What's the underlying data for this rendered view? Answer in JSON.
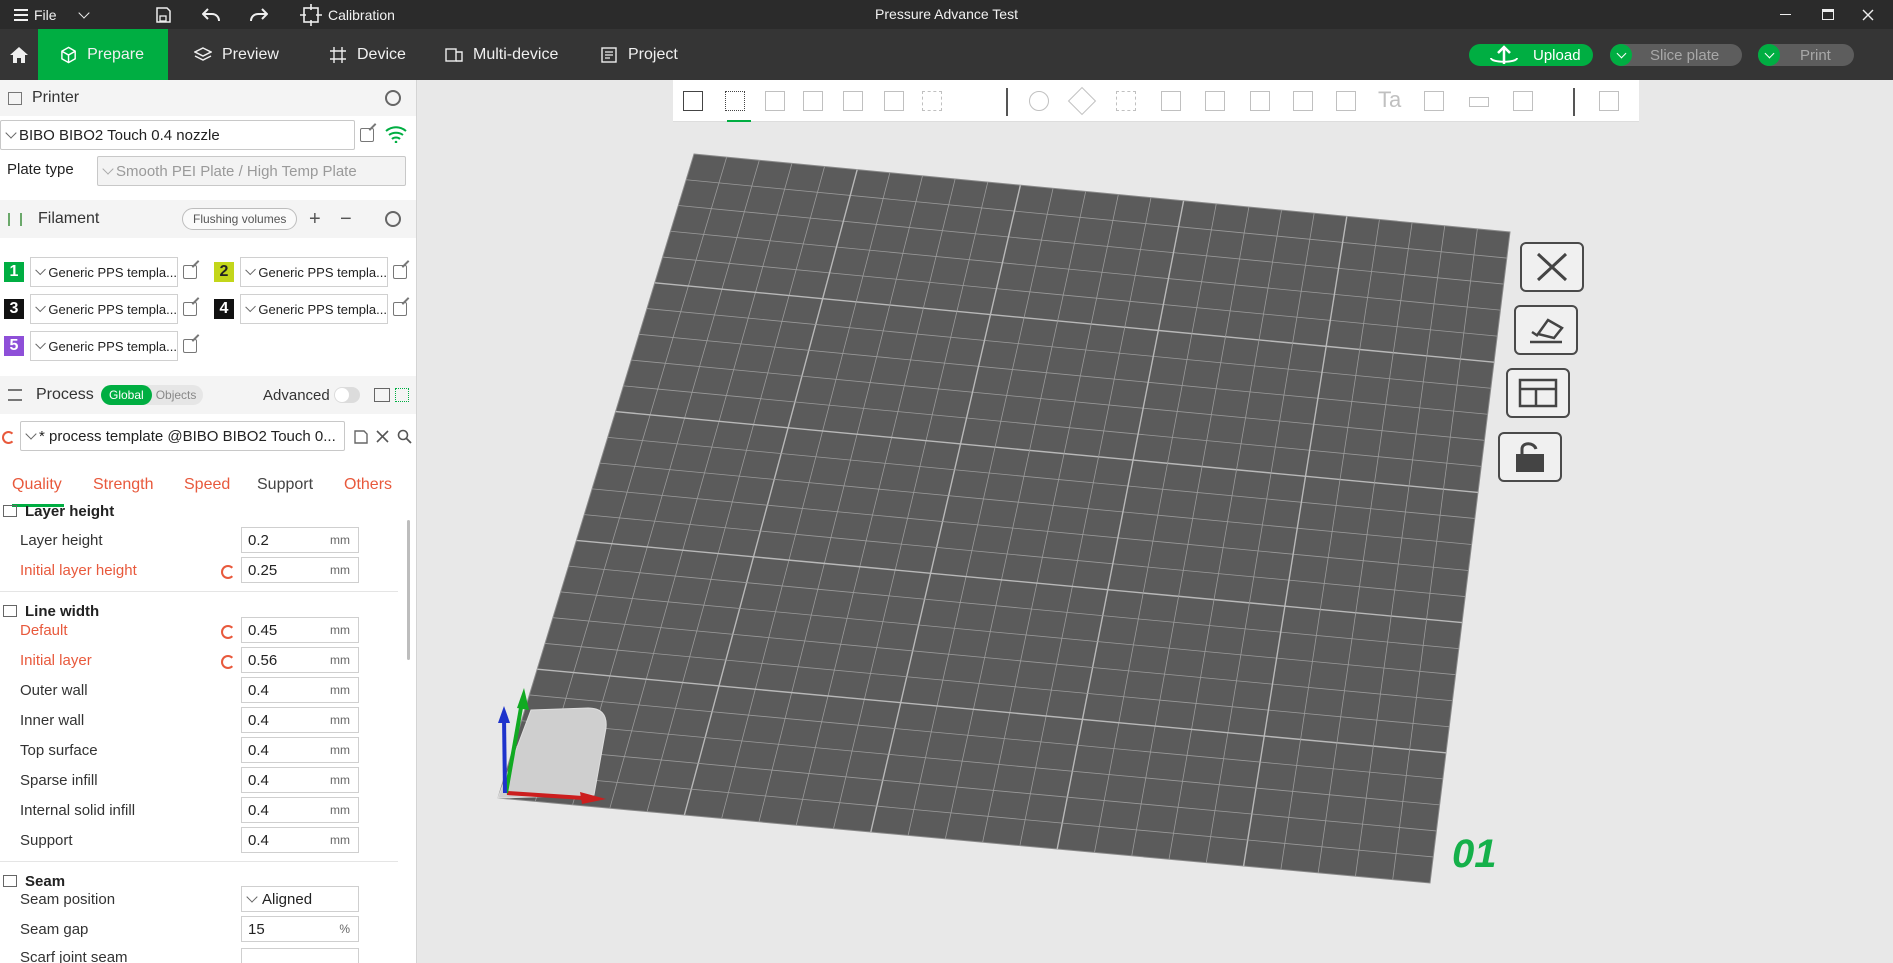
{
  "titlebar": {
    "file_label": "File",
    "calibration_label": "Calibration",
    "window_title": "Pressure Advance Test"
  },
  "nav": {
    "tabs": [
      {
        "label": "Prepare"
      },
      {
        "label": "Preview"
      },
      {
        "label": "Device"
      },
      {
        "label": "Multi-device"
      },
      {
        "label": "Project"
      }
    ],
    "upload_label": "Upload",
    "slice_label": "Slice plate",
    "print_label": "Print",
    "accent": "#00ae42"
  },
  "printer": {
    "section_label": "Printer",
    "selected": "BIBO BIBO2 Touch 0.4 nozzle",
    "plate_type_label": "Plate type",
    "plate_type_value": "Smooth PEI Plate / High Temp Plate"
  },
  "filament": {
    "section_label": "Filament",
    "flushing_label": "Flushing volumes",
    "slots": [
      {
        "num": "1",
        "color": "#00ae42",
        "name": "Generic PPS templa..."
      },
      {
        "num": "2",
        "color": "#c3d61a",
        "name": "Generic PPS templa..."
      },
      {
        "num": "3",
        "color": "#111111",
        "name": "Generic PPS templa..."
      },
      {
        "num": "4",
        "color": "#111111",
        "name": "Generic PPS templa..."
      },
      {
        "num": "5",
        "color": "#8e4fd8",
        "name": "Generic PPS templa..."
      }
    ]
  },
  "process": {
    "section_label": "Process",
    "toggle_global": "Global",
    "toggle_objects": "Objects",
    "advanced_label": "Advanced",
    "preset": "* process template @BIBO BIBO2 Touch 0...",
    "tabs": [
      "Quality",
      "Strength",
      "Speed",
      "Support",
      "Others"
    ],
    "groups": {
      "layer_height": {
        "title": "Layer height",
        "options": [
          {
            "label": "Layer height",
            "value": "0.2",
            "unit": "mm"
          },
          {
            "label": "Initial layer height",
            "value": "0.25",
            "unit": "mm"
          }
        ]
      },
      "line_width": {
        "title": "Line width",
        "options": [
          {
            "label": "Default",
            "value": "0.45",
            "unit": "mm"
          },
          {
            "label": "Initial layer",
            "value": "0.56",
            "unit": "mm"
          },
          {
            "label": "Outer wall",
            "value": "0.4",
            "unit": "mm"
          },
          {
            "label": "Inner wall",
            "value": "0.4",
            "unit": "mm"
          },
          {
            "label": "Top surface",
            "value": "0.4",
            "unit": "mm"
          },
          {
            "label": "Sparse infill",
            "value": "0.4",
            "unit": "mm"
          },
          {
            "label": "Internal solid infill",
            "value": "0.4",
            "unit": "mm"
          },
          {
            "label": "Support",
            "value": "0.4",
            "unit": "mm"
          }
        ]
      },
      "seam": {
        "title": "Seam",
        "options": [
          {
            "label": "Seam position",
            "value": "Aligned"
          },
          {
            "label": "Seam gap",
            "value": "15",
            "unit": "%"
          },
          {
            "label": "Scarf joint seam",
            "value": ""
          }
        ]
      }
    }
  },
  "viewport": {
    "plate_number": "01",
    "plate_color": "#5b5b5b",
    "grid_line_color": "#9a9a9a"
  }
}
